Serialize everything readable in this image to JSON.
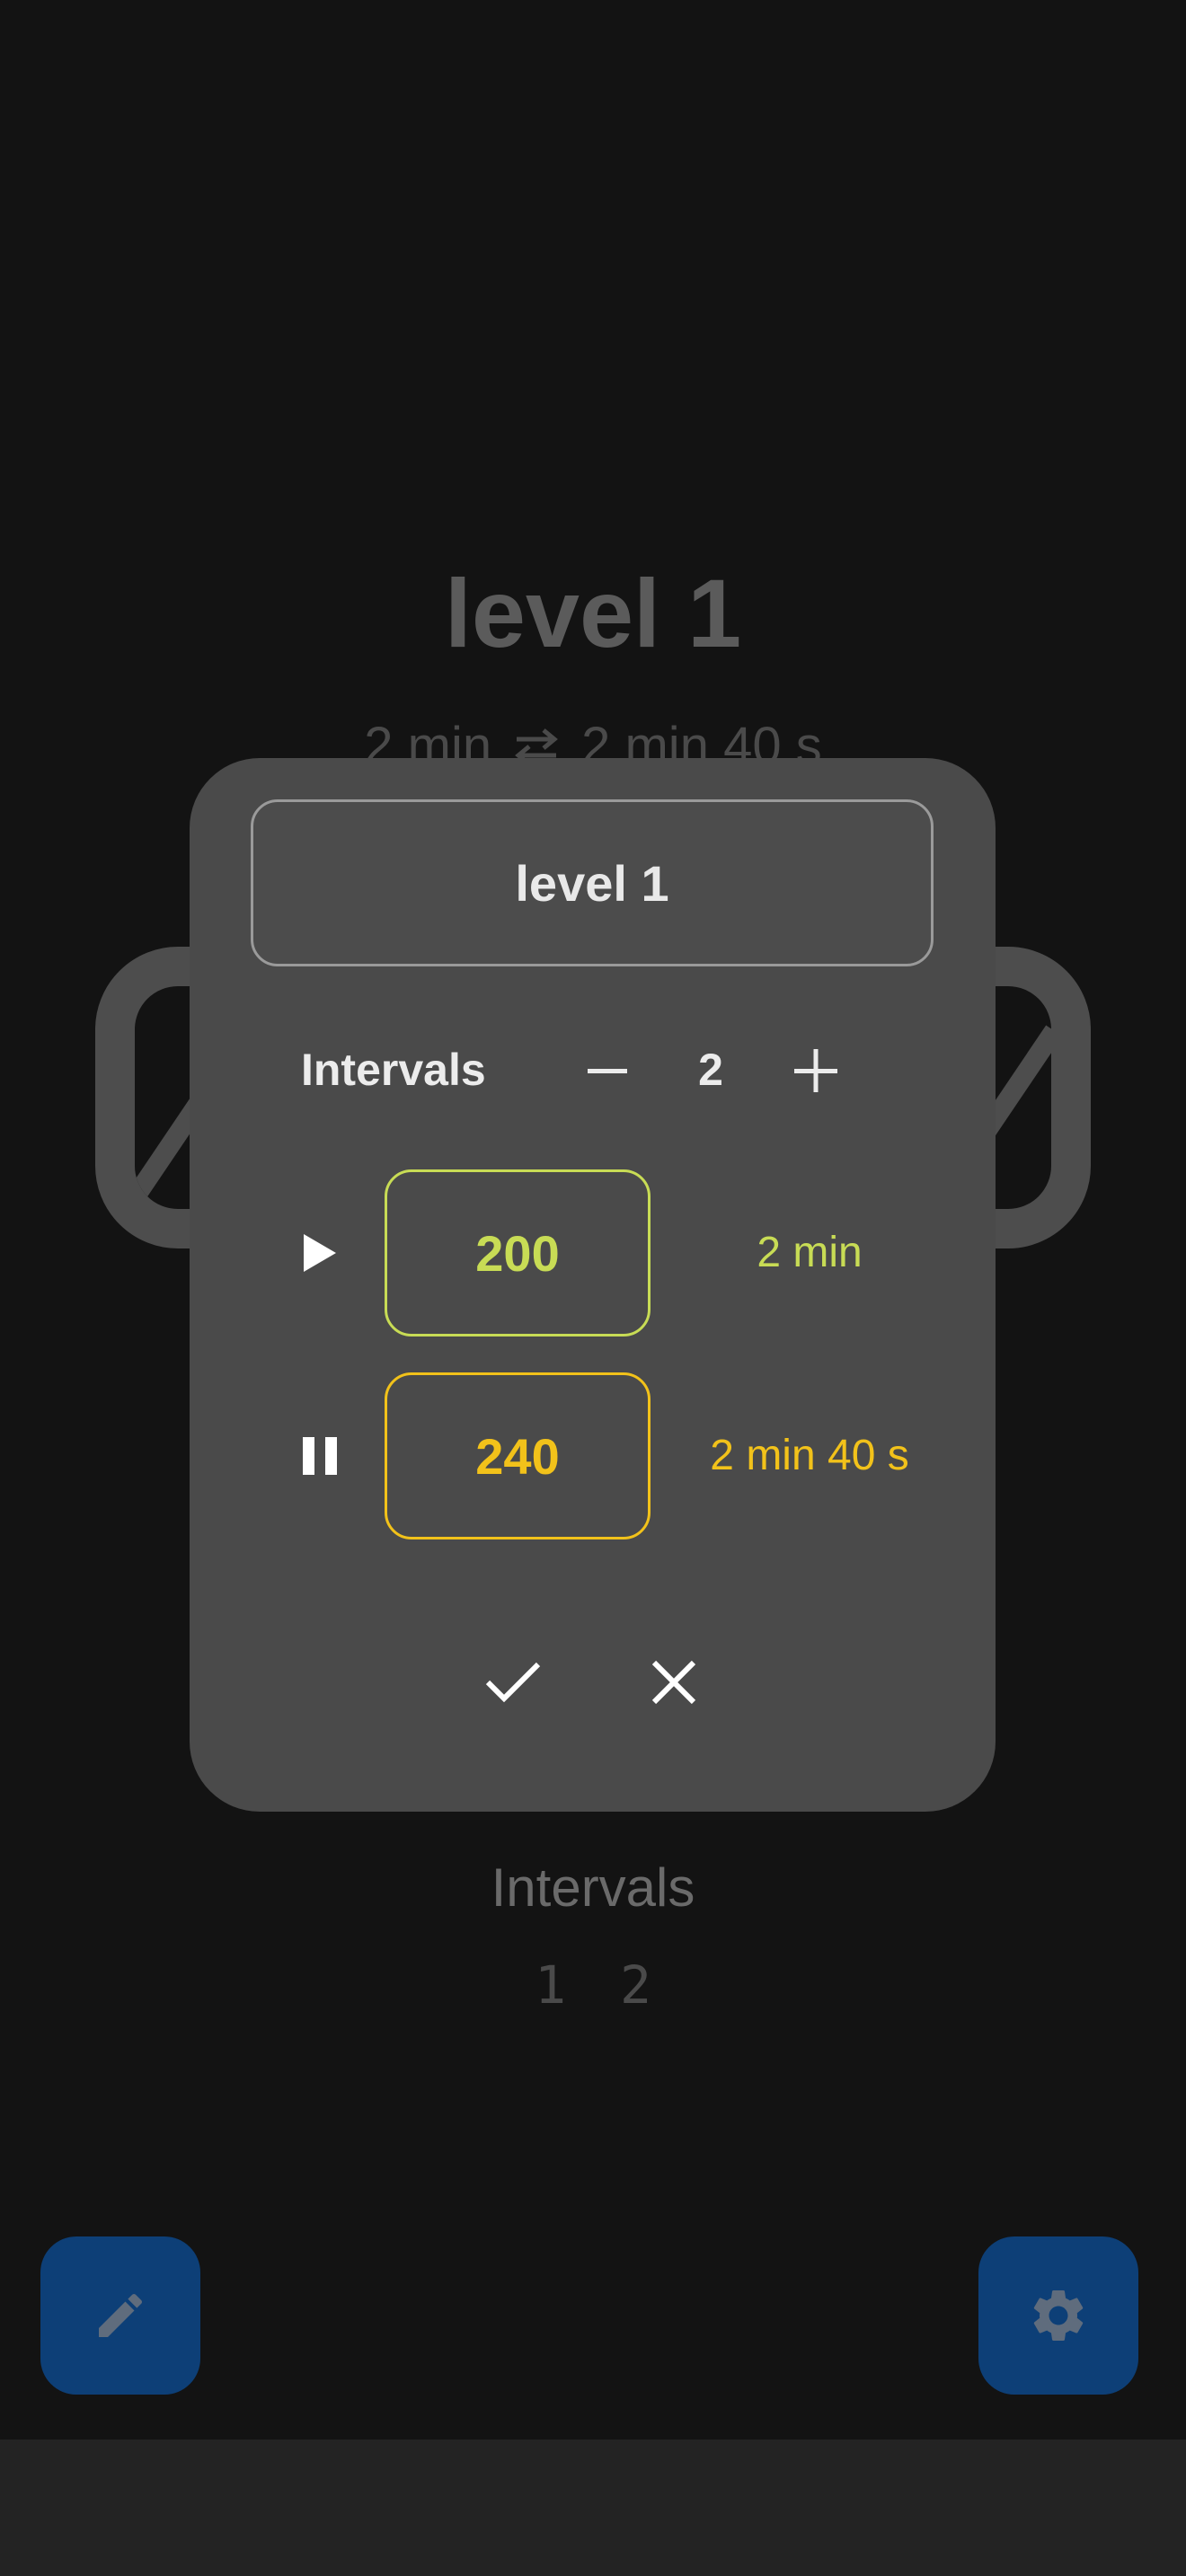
{
  "background": {
    "title": "level 1",
    "subtitle": {
      "work_time": "2 min",
      "swap_icon": "swap-arrows-icon",
      "rest_time": "2 min 40 s"
    },
    "intervals_label": "Intervals",
    "interval_numbers": [
      "1",
      "2"
    ],
    "fab_edit_icon": "pencil-icon",
    "fab_settings_icon": "gear-icon"
  },
  "dialog": {
    "name_value": "level 1",
    "intervals": {
      "label": "Intervals",
      "value": "2",
      "minus_icon": "minus-icon",
      "plus_icon": "plus-icon"
    },
    "work": {
      "icon": "play-icon",
      "value": "200",
      "duration": "2 min",
      "color": "#c8dc55"
    },
    "rest": {
      "icon": "pause-icon",
      "value": "240",
      "duration": "2 min 40 s",
      "color": "#f2c21a"
    },
    "confirm_icon": "check-icon",
    "cancel_icon": "close-icon"
  },
  "colors": {
    "background": "#131313",
    "dialog": "#4a4a4a",
    "fab": "#0d3f77",
    "nav_bar": "#232323"
  }
}
